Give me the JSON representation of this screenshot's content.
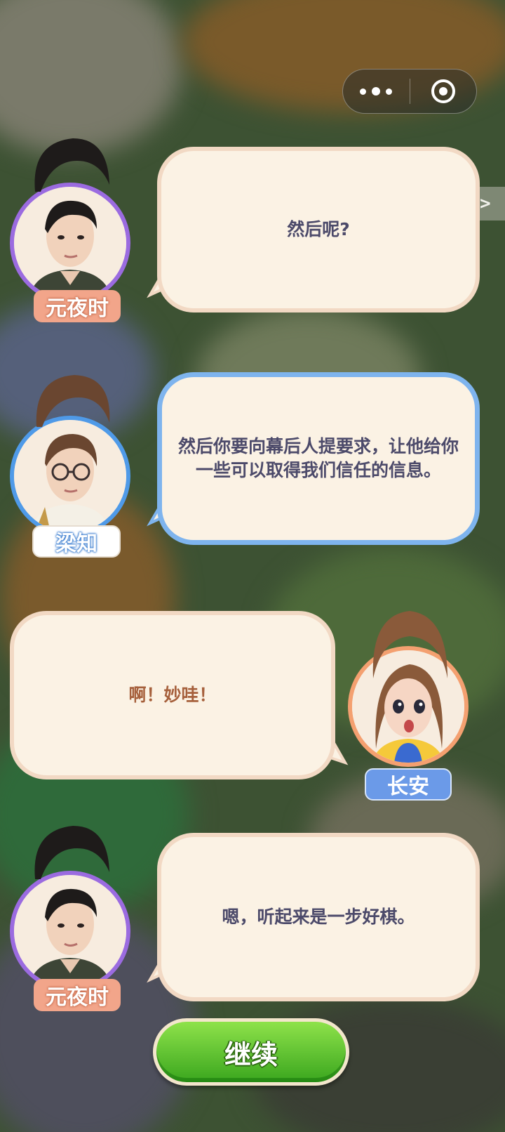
{
  "capsule": {
    "more_icon": "more-dots-icon",
    "close_icon": "target-circle-icon"
  },
  "skip_label": ">>",
  "dialogue": [
    {
      "speaker": "元夜时",
      "text": "然后呢?",
      "side": "left",
      "ring_color": "#9b6be0",
      "tag_color": "#f2a58a"
    },
    {
      "speaker": "梁知",
      "text": "然后你要向幕后人提要求，让他给你一些可以取得我们信任的信息。",
      "side": "left",
      "ring_color": "#4f9ae8",
      "tag_color": "#ffffff"
    },
    {
      "speaker": "长安",
      "text": "啊！妙哇！",
      "side": "right",
      "ring_color": "#f4a070",
      "tag_color": "#6b9ae8"
    },
    {
      "speaker": "元夜时",
      "text": "嗯，听起来是一步好棋。",
      "side": "left",
      "ring_color": "#9b6be0",
      "tag_color": "#f2a58a"
    }
  ],
  "continue_label": "继续"
}
